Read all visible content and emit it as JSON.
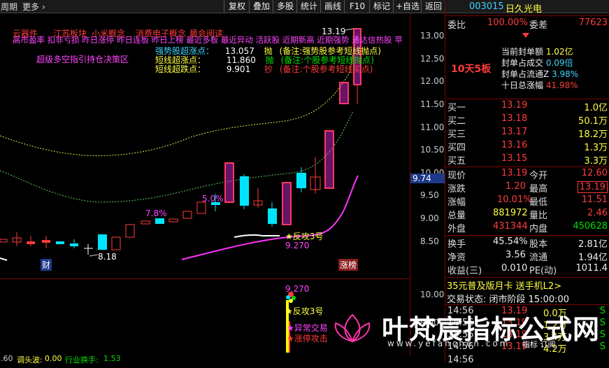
{
  "topbar": {
    "left_label": "周期",
    "more_label": "更多",
    "more_chevron": "›",
    "buttons": [
      "复权",
      "叠加",
      "多股",
      "统计",
      "画线",
      "F10",
      "标记",
      "+自选",
      "返回"
    ]
  },
  "overlay": {
    "line1_items": [
      "云器件",
      "江苏板块",
      "小米概念",
      "消费电子概念",
      "最会阅读"
    ],
    "line2": "高市盈率 扣非亏损 昨日涨停 昨日连板 昨日上榜 最近多板 最近异动 活跃股 近期新高 近期强势 通达信热股 苹",
    "side_text": "超级多空指引持仓决策区",
    "rows": [
      {
        "label": "强势股超涨点：",
        "value": "13.057",
        "tag": "抛",
        "note": "(备注:强势股参考短线抛点)"
      },
      {
        "label": "短线超涨点：",
        "value": "11.860",
        "tag": "抛",
        "note": "(备注:个股参考短线抛点)"
      },
      {
        "label": "短线超跌点：",
        "value": "9.901",
        "tag": "抄",
        "note": "(备注:个股参考短线买点)"
      }
    ],
    "top_price": "13.19",
    "pct_labels": [
      "5.0%",
      "7.8%"
    ],
    "low_price": "8.18",
    "rebound_label": "反攻3号",
    "rebound_price": "9.270",
    "cai_label": "财",
    "zhangbang_label": "涨榜"
  },
  "axis": {
    "labels": [
      "13.00",
      "12.50",
      "12.00",
      "11.50",
      "11.00",
      "10.50",
      "10.00",
      "9.50",
      "9.00",
      "8.50"
    ],
    "current": "9.74",
    "sub_labels": [
      "10.00",
      "9.00"
    ]
  },
  "sub": {
    "price": "9.270",
    "label1": "反攻3号",
    "label2": "异常交易",
    "label3": "涨停攻击"
  },
  "bottom": {
    "left": ".60",
    "item1_label": "调头波:",
    "item1_value": "0.00",
    "item2_label": "行业换手:",
    "item2_value": "1.53"
  },
  "panel": {
    "code": "003015",
    "name": "日久光电",
    "weibi_label": "委比",
    "weibi_value": "100.00%",
    "weicha_label": "委差",
    "weicha_value": "77623",
    "limit_badge": "10天5板",
    "stats": [
      {
        "label": "当前封单额",
        "value": "1.02亿"
      },
      {
        "label": "封单占成交",
        "value": "0.09倍"
      },
      {
        "label": "封单占流通Z",
        "value": "3.98%"
      },
      {
        "label": "十日总涨幅",
        "value": "41.98%"
      }
    ],
    "bids": [
      {
        "label": "买一",
        "price": "13.19",
        "vol": "1.0亿"
      },
      {
        "label": "买二",
        "price": "13.18",
        "vol": "50.1万"
      },
      {
        "label": "买三",
        "price": "13.17",
        "vol": "18.2万"
      },
      {
        "label": "买四",
        "price": "13.16",
        "vol": "1.3万"
      },
      {
        "label": "买五",
        "price": "13.15",
        "vol": "3.3万"
      }
    ],
    "quote": [
      {
        "l1": "现价",
        "v1": "13.19",
        "l2": "今开",
        "v2": "12.60"
      },
      {
        "l1": "涨跌",
        "v1": "1.20",
        "l2": "最高",
        "v2": "13.19"
      },
      {
        "l1": "涨幅",
        "v1": "10.01%",
        "l2": "最低",
        "v2": "11.51"
      },
      {
        "l1": "总量",
        "v1": "881972",
        "l2": "量比",
        "v2": "2.46"
      },
      {
        "l1": "外盘",
        "v1": "431344",
        "l2": "内盘",
        "v2": "450628"
      }
    ],
    "fund": [
      {
        "l1": "换手",
        "v1": "45.54%",
        "l2": "股本",
        "v2": "2.81亿"
      },
      {
        "l1": "净资",
        "v1": "3.56",
        "l2": "流通",
        "v2": "1.94亿"
      },
      {
        "l1": "收益(三)",
        "v1": "0.010",
        "l2": "PE(动)",
        "v2": "1011.4"
      }
    ],
    "ad": "35元普及版月卡 送手机L2>",
    "status_label": "交易状态:",
    "status_value": "闭市阶段 15:00:00",
    "ticks": [
      {
        "time": "14:56",
        "price": "13.19",
        "vol": "0.0万",
        "flag": "S"
      },
      {
        "time": "14:56",
        "price": "13.19",
        "vol": "1.2万",
        "flag": "S"
      },
      {
        "time": "14:56",
        "price": "13.19",
        "vol": "3.4万",
        "flag": "S"
      },
      {
        "time": "14:56",
        "price": "13.19",
        "vol": "4.2万",
        "flag": "S"
      }
    ],
    "tick_tabs": "指标 订阅",
    "last_time": "14:56"
  },
  "watermark": {
    "cn": "叶梵宸指标公式网",
    "url": "www.yefanchen.com"
  },
  "colors": {
    "up": "#ff3b3b",
    "down": "#00e5ff",
    "axis_border": "#7a0000",
    "ma": "#ffffff",
    "magenta": "#ff33ff"
  }
}
